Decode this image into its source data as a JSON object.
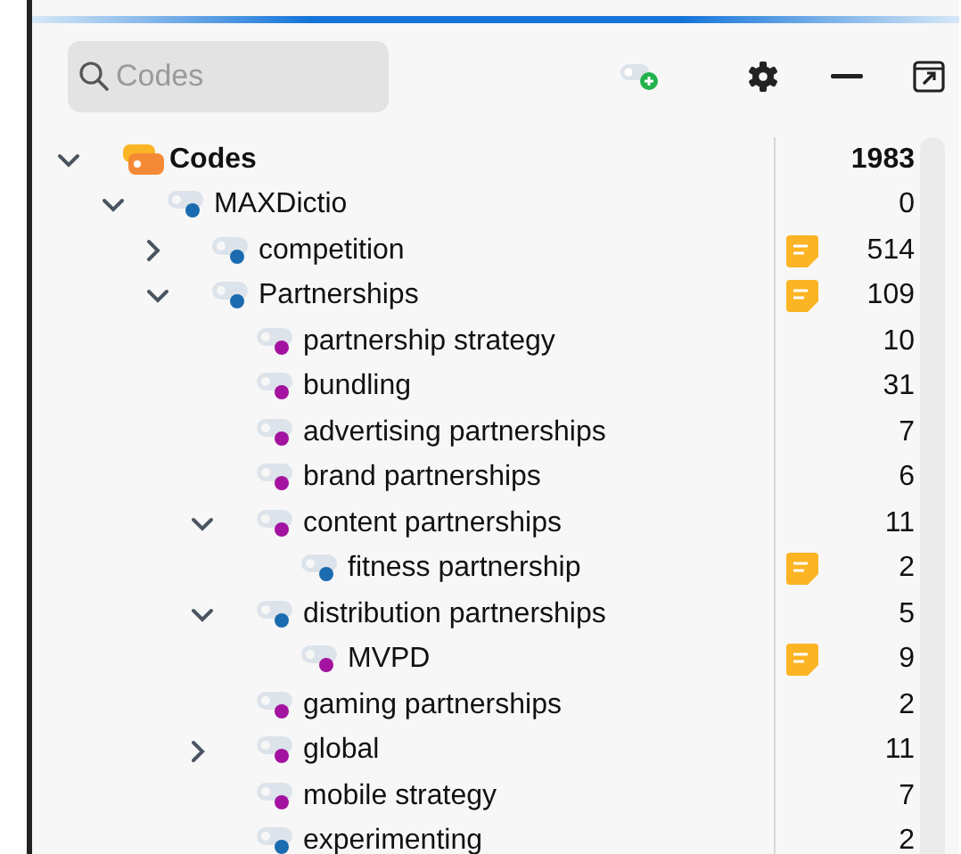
{
  "search": {
    "placeholder": "Codes"
  },
  "tree": [
    {
      "label": "Codes",
      "kind": "root",
      "count": "1983",
      "memo": false,
      "expanded": true,
      "children": [
        {
          "label": "MAXDictio",
          "color": "#1a6bb0",
          "count": "0",
          "memo": false,
          "expanded": true,
          "children": [
            {
              "label": "competition",
              "color": "#1a6bb0",
              "count": "514",
              "memo": true,
              "expanded": false
            },
            {
              "label": "Partnerships",
              "color": "#1a6bb0",
              "count": "109",
              "memo": true,
              "expanded": true,
              "children": [
                {
                  "label": "partnership strategy",
                  "color": "#a3139f",
                  "count": "10",
                  "memo": false
                },
                {
                  "label": "bundling",
                  "color": "#a3139f",
                  "count": "31",
                  "memo": false
                },
                {
                  "label": "advertising partnerships",
                  "color": "#a3139f",
                  "count": "7",
                  "memo": false
                },
                {
                  "label": "brand partnerships",
                  "color": "#a3139f",
                  "count": "6",
                  "memo": false
                },
                {
                  "label": "content partnerships",
                  "color": "#a3139f",
                  "count": "11",
                  "memo": false,
                  "expanded": true,
                  "children": [
                    {
                      "label": "fitness partnership",
                      "color": "#1a6bb0",
                      "count": "2",
                      "memo": true
                    }
                  ]
                },
                {
                  "label": "distribution partnerships",
                  "color": "#1a6bb0",
                  "count": "5",
                  "memo": false,
                  "expanded": true,
                  "children": [
                    {
                      "label": "MVPD",
                      "color": "#a3139f",
                      "count": "9",
                      "memo": true
                    }
                  ]
                },
                {
                  "label": "gaming partnerships",
                  "color": "#a3139f",
                  "count": "2",
                  "memo": false
                },
                {
                  "label": "global",
                  "color": "#a3139f",
                  "count": "11",
                  "memo": false,
                  "expanded": false
                },
                {
                  "label": "mobile strategy",
                  "color": "#a3139f",
                  "count": "7",
                  "memo": false
                },
                {
                  "label": "experimenting",
                  "color": "#1a6bb0",
                  "count": "2",
                  "memo": false
                }
              ]
            }
          ]
        }
      ]
    }
  ]
}
